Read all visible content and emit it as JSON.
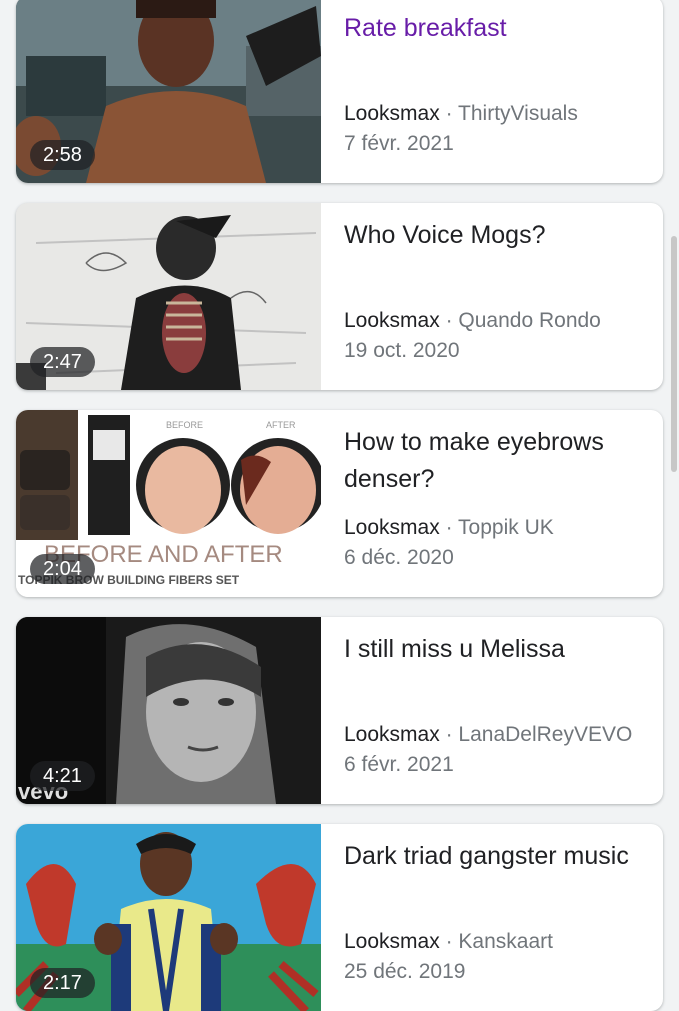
{
  "separator": "·",
  "videos": [
    {
      "title": "Rate breakfast",
      "duration": "2:58",
      "site": "Looksmax",
      "channel": "ThirtyVisuals",
      "date": "7 févr. 2021",
      "visited": true
    },
    {
      "title": "Who Voice Mogs?",
      "duration": "2:47",
      "site": "Looksmax",
      "channel": "Quando Rondo",
      "date": "19 oct. 2020",
      "visited": false
    },
    {
      "title": "How to make eyebrows denser?",
      "duration": "2:04",
      "site": "Looksmax",
      "channel": "Toppik UK",
      "date": "6 déc. 2020",
      "visited": false,
      "thumb_text": {
        "before": "BEFORE",
        "after": "AFTER",
        "banner": "BEFORE AND AFTER",
        "subbanner": "TOPPIK BROW BUILDING FIBERS SET"
      }
    },
    {
      "title": "I still miss u Melissa",
      "duration": "4:21",
      "site": "Looksmax",
      "channel": "LanaDelReyVEVO",
      "date": "6 févr. 2021",
      "visited": false,
      "thumb_text": {
        "watermark": "vevo"
      }
    },
    {
      "title": "Dark triad gangster music",
      "duration": "2:17",
      "site": "Looksmax",
      "channel": "Kanskaart",
      "date": "25 déc. 2019",
      "visited": false
    }
  ]
}
